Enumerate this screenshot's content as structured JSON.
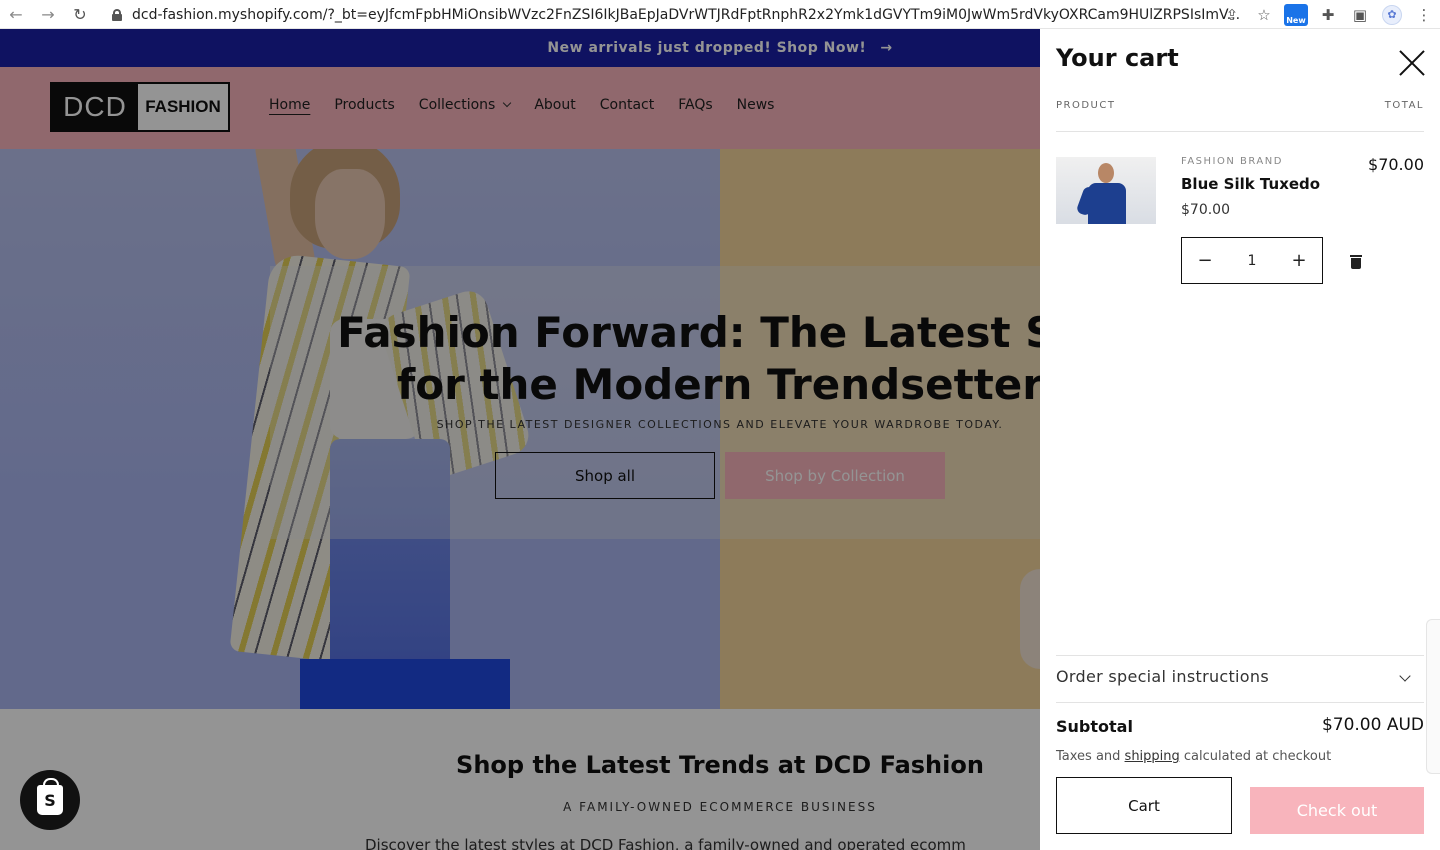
{
  "browser": {
    "url": "dcd-fashion.myshopify.com/?_bt=eyJfcmFpbHMiOnsibWVzc2FnZSI6IkJBaEpJaDVrWTJRdFptRnphR2x2Ymk1dGVYTm9iM0JwWm5rdVkyOXRCam9HUlZRPSIsImV...",
    "new_badge": "New"
  },
  "announcement": {
    "text": "New arrivals just dropped! Shop Now!",
    "arrow": "→"
  },
  "logo": {
    "left": "DCD",
    "right": "FASHION"
  },
  "nav": {
    "items": [
      {
        "label": "Home",
        "active": true
      },
      {
        "label": "Products"
      },
      {
        "label": "Collections",
        "has_dropdown": true
      },
      {
        "label": "About"
      },
      {
        "label": "Contact"
      },
      {
        "label": "FAQs"
      },
      {
        "label": "News"
      }
    ]
  },
  "hero": {
    "title_line1": "Fashion Forward: The Latest Sty",
    "title_line2": "for the Modern Trendsetter",
    "subtitle": "SHOP THE LATEST DESIGNER COLLECTIONS AND ELEVATE YOUR WARDROBE TODAY.",
    "primary_button": "Shop all",
    "secondary_button": "Shop by Collection"
  },
  "intro": {
    "title": "Shop the Latest Trends at DCD Fashion",
    "subtitle": "A FAMILY-OWNED ECOMMERCE BUSINESS",
    "body": "Discover the latest styles at DCD Fashion, a family-owned and operated ecomm"
  },
  "cart": {
    "title": "Your cart",
    "col_product": "PRODUCT",
    "col_total": "TOTAL",
    "item": {
      "brand": "FASHION BRAND",
      "name": "Blue Silk Tuxedo",
      "price": "$70.00",
      "line_total": "$70.00",
      "quantity": "1",
      "minus": "−",
      "plus": "+"
    },
    "instructions_label": "Order special instructions",
    "subtotal_label": "Subtotal",
    "subtotal_value": "$70.00 AUD",
    "tax_note_before": "Taxes and ",
    "tax_note_link": "shipping",
    "tax_note_after": " calculated at checkout",
    "cart_button": "Cart",
    "checkout_button": "Check out"
  },
  "colors": {
    "announcement_bg": "#1a1fa8",
    "header_bg": "#f8b4bc",
    "accent_pink": "#f8b4bc",
    "overlay": "rgba(0,0,0,0.42)"
  },
  "icons": [
    "back-arrow-icon",
    "forward-arrow-icon",
    "reload-icon",
    "lock-icon",
    "share-icon",
    "star-icon",
    "extension-icon",
    "puzzle-icon",
    "sidebar-icon",
    "profile-icon",
    "menu-dots-icon",
    "chevron-down-icon",
    "close-icon",
    "trash-icon",
    "shopify-bag-icon"
  ]
}
